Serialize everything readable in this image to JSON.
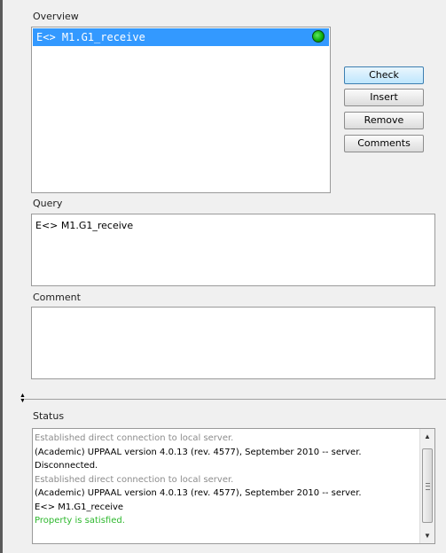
{
  "overview": {
    "label": "Overview",
    "items": [
      {
        "text": "E<> M1.G1_receive",
        "status": "satisfied"
      }
    ]
  },
  "buttons": {
    "check": "Check",
    "insert": "Insert",
    "remove": "Remove",
    "comments": "Comments"
  },
  "query": {
    "label": "Query",
    "value": "E<> M1.G1_receive"
  },
  "comment": {
    "label": "Comment",
    "value": ""
  },
  "status": {
    "label": "Status",
    "lines": [
      {
        "text": "Established direct connection to local server.",
        "kind": "info"
      },
      {
        "text": "(Academic) UPPAAL version 4.0.13 (rev. 4577), September 2010 -- server.",
        "kind": "normal"
      },
      {
        "text": "Disconnected.",
        "kind": "normal"
      },
      {
        "text": "Established direct connection to local server.",
        "kind": "info"
      },
      {
        "text": "(Academic) UPPAAL version 4.0.13 (rev. 4577), September 2010 -- server.",
        "kind": "normal"
      },
      {
        "text": "E<> M1.G1_receive",
        "kind": "normal"
      },
      {
        "text": "Property is satisfied.",
        "kind": "success"
      }
    ]
  },
  "colors": {
    "selection": "#3399ff",
    "satisfied": "#1ec81e",
    "success_text": "#2eb82e",
    "info_text": "#8c8c8c"
  },
  "icons": {
    "status_dot": "green-circle-icon",
    "scroll_up": "triangle-up-icon",
    "scroll_down": "triangle-down-icon",
    "splitter": "splitter-arrows-icon"
  }
}
